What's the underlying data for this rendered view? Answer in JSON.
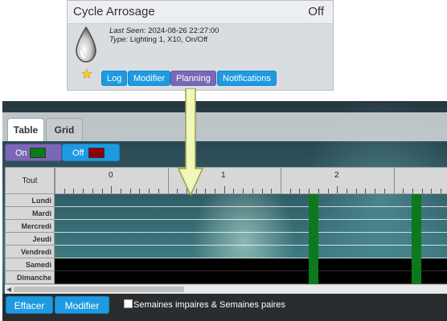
{
  "device": {
    "title": "Cycle Arrosage",
    "status": "Off",
    "last_seen_label": "Last Seen:",
    "last_seen_value": "2024-08-26 22:27:00",
    "type_label": "Type:",
    "type_value": "Lighting 1, X10, On/Off",
    "icon": "water-drop-icon",
    "favorite_icon": "star-icon",
    "buttons": [
      "Log",
      "Modifier",
      "Planning",
      "Notifications"
    ],
    "active_button": "Planning"
  },
  "planner": {
    "tabs": [
      "Table",
      "Grid"
    ],
    "active_tab": "Table",
    "modes": [
      {
        "label": "On",
        "color": "#0a7a1a"
      },
      {
        "label": "Off",
        "color": "#8b0000"
      }
    ],
    "corner_label": "Tout",
    "hours": [
      "0",
      "1",
      "2"
    ],
    "days": [
      {
        "label": "Lundi",
        "state": "clear"
      },
      {
        "label": "Mardi",
        "state": "clear"
      },
      {
        "label": "Mercredi",
        "state": "clear"
      },
      {
        "label": "Jeudi",
        "state": "clear"
      },
      {
        "label": "Vendredi",
        "state": "clear"
      },
      {
        "label": "Samedi",
        "state": "off"
      },
      {
        "label": "Dimanche",
        "state": "off"
      }
    ],
    "on_slot_color": "#0c7a1c",
    "footer": {
      "clear_label": "Effacer",
      "edit_label": "Modifier",
      "weeks_label": "Semaines impaires & Semaines paires"
    }
  }
}
